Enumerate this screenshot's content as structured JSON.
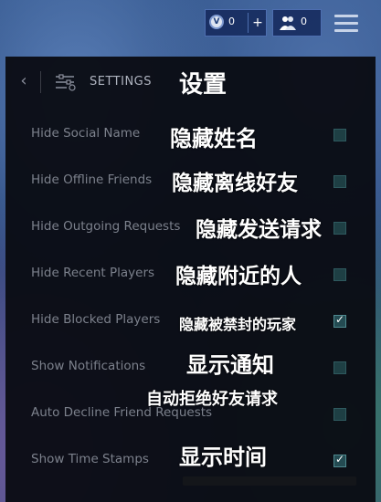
{
  "topbar": {
    "vbucks_icon_glyph": "V",
    "vbucks_count": "0",
    "plus_label": "+",
    "friends_count": "0"
  },
  "header": {
    "back_glyph": "‹",
    "title": "SETTINGS",
    "title_cn": "设置"
  },
  "options": [
    {
      "label": "Hide Social Name",
      "label_cn": "隐藏姓名",
      "checked": false
    },
    {
      "label": "Hide Offline Friends",
      "label_cn": "隐藏离线好友",
      "checked": false
    },
    {
      "label": "Hide Outgoing Requests",
      "label_cn": "隐藏发送请求",
      "checked": false
    },
    {
      "label": "Hide Recent Players",
      "label_cn": "隐藏附近的人",
      "checked": false
    },
    {
      "label": "Hide Blocked Players",
      "label_cn": "隐藏被禁封的玩家",
      "checked": true
    },
    {
      "label": "Show Notifications",
      "label_cn": "显示通知",
      "checked": false
    },
    {
      "label": "Auto Decline Friend Requests",
      "label_cn": "自动拒绝好友请求",
      "checked": false
    },
    {
      "label": "Show Time Stamps",
      "label_cn": "显示时间",
      "checked": true
    }
  ],
  "colors": {
    "panel_bg": "#0a0c14",
    "checkbox_bg": "#1e3f44",
    "accent_highlight": "#f5f0a8"
  }
}
